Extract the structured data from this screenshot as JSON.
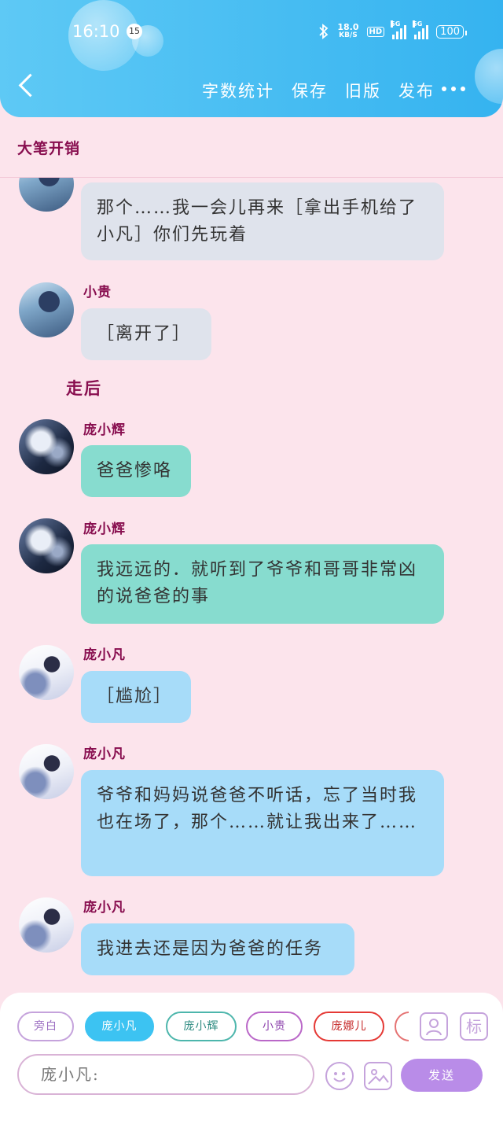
{
  "status_bar": {
    "time": "16:10",
    "notification_count": "15",
    "net_speed_value": "18.0",
    "net_speed_unit": "KB/S",
    "hd_label": "HD",
    "sim1": "5G",
    "sim2": "5G",
    "battery": "100"
  },
  "toolbar": {
    "word_count": "字数统计",
    "save": "保存",
    "old_version": "旧版",
    "publish": "发布"
  },
  "story_title": "大笔开销",
  "messages": [
    {
      "name": "",
      "text": "那个……我一会儿再来［拿出手机给了小凡］你们先玩着"
    },
    {
      "name": "小贵",
      "text": "［离开了］"
    },
    {
      "narration": "走后"
    },
    {
      "name": "庞小辉",
      "text": "爸爸惨咯"
    },
    {
      "name": "庞小辉",
      "text": "我远远的．就听到了爷爷和哥哥非常凶的说爸爸的事"
    },
    {
      "name": "庞小凡",
      "text": "［尴尬］"
    },
    {
      "name": "庞小凡",
      "text": "爷爷和妈妈说爸爸不听话，忘了当时我也在场了，那个……就让我出来了……"
    },
    {
      "name": "庞小凡",
      "text": "我进去还是因为爸爸的任务"
    }
  ],
  "roles": [
    {
      "label": "旁白",
      "color": "#c5a3dc"
    },
    {
      "label": "庞小凡",
      "color": "#3cc3f2",
      "active": true
    },
    {
      "label": "庞小辉",
      "color": "#4db6ac"
    },
    {
      "label": "小贵",
      "color": "#ba68c8"
    },
    {
      "label": "庞娜儿",
      "color": "#e53935"
    }
  ],
  "tag_button_label": "标",
  "input": {
    "value": "庞小凡:"
  },
  "send_label": "发送",
  "colors": {
    "header": "#35b3f0",
    "background": "#fce4ec",
    "name_color": "#880e4f",
    "send_button": "#b98ce8"
  }
}
